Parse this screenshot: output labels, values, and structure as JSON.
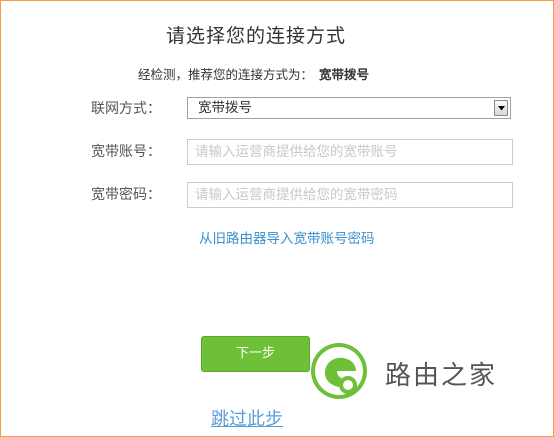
{
  "title": "请选择您的连接方式",
  "detection": {
    "prefix": "经检测，推荐您的连接方式为：",
    "result": "宽带拨号"
  },
  "form": {
    "connection_type": {
      "label": "联网方式：",
      "selected": "宽带拨号"
    },
    "account": {
      "label": "宽带账号：",
      "placeholder": "请输入运营商提供给您的宽带账号",
      "value": ""
    },
    "password": {
      "label": "宽带密码：",
      "placeholder": "请输入运营商提供给您的宽带密码",
      "value": ""
    },
    "import_link": "从旧路由器导入宽带账号密码"
  },
  "actions": {
    "next_label": "下一步",
    "skip_label": "跳过此步"
  },
  "watermark": {
    "text": "路由之家",
    "icon": "watermark-logo-icon"
  },
  "colors": {
    "border": "#f0a040",
    "next_button": "#6ec038",
    "link": "#3a8fd0",
    "skip_link": "#5a9bd8",
    "watermark_green": "#6ec038"
  }
}
